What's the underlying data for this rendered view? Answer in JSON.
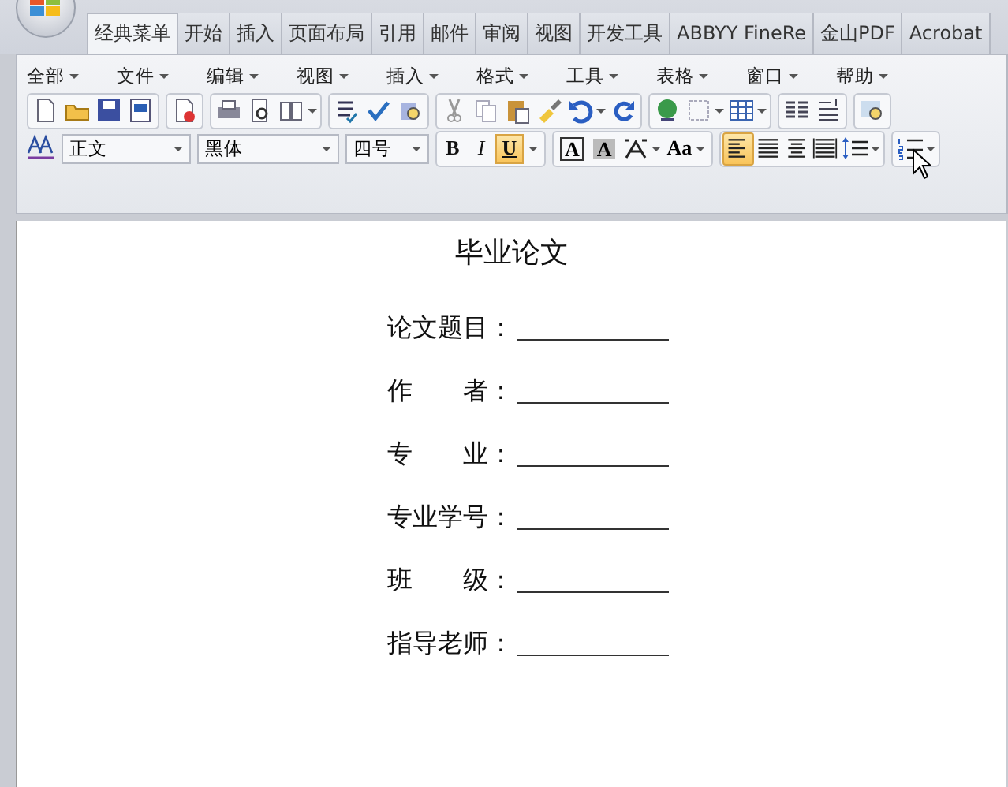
{
  "tabs": [
    {
      "label": "经典菜单",
      "selected": true
    },
    {
      "label": "开始",
      "selected": false
    },
    {
      "label": "插入",
      "selected": false
    },
    {
      "label": "页面布局",
      "selected": false
    },
    {
      "label": "引用",
      "selected": false
    },
    {
      "label": "邮件",
      "selected": false
    },
    {
      "label": "审阅",
      "selected": false
    },
    {
      "label": "视图",
      "selected": false
    },
    {
      "label": "开发工具",
      "selected": false
    },
    {
      "label": "ABBYY FineRe",
      "selected": false
    },
    {
      "label": "金山PDF",
      "selected": false
    },
    {
      "label": "Acrobat",
      "selected": false
    }
  ],
  "menu": [
    "全部",
    "文件",
    "编辑",
    "视图",
    "插入",
    "格式",
    "工具",
    "表格",
    "窗口",
    "帮助"
  ],
  "style_box": {
    "value": "正文"
  },
  "font_box": {
    "value": "黑体"
  },
  "size_box": {
    "value": "四号"
  },
  "format_buttons": [
    {
      "kind": "bold",
      "label": "B",
      "selected": false
    },
    {
      "kind": "italic",
      "label": "I",
      "selected": false
    },
    {
      "kind": "underline",
      "label": "U",
      "selected": true
    }
  ],
  "char_buttons": [
    {
      "kind": "border",
      "label": "A"
    },
    {
      "kind": "shade",
      "label": "A"
    },
    {
      "kind": "case",
      "label": "Aa"
    }
  ],
  "align_buttons": [
    {
      "kind": "left",
      "selected": true
    },
    {
      "kind": "justify",
      "selected": false
    },
    {
      "kind": "center",
      "selected": false
    },
    {
      "kind": "distributed",
      "selected": false
    }
  ],
  "document": {
    "title": "毕业论文",
    "fields": [
      {
        "label": "论文题目："
      },
      {
        "label": "作　　者："
      },
      {
        "label": "专　　业："
      },
      {
        "label": "专业学号："
      },
      {
        "label": "班　　级："
      },
      {
        "label": "指导老师："
      }
    ]
  }
}
